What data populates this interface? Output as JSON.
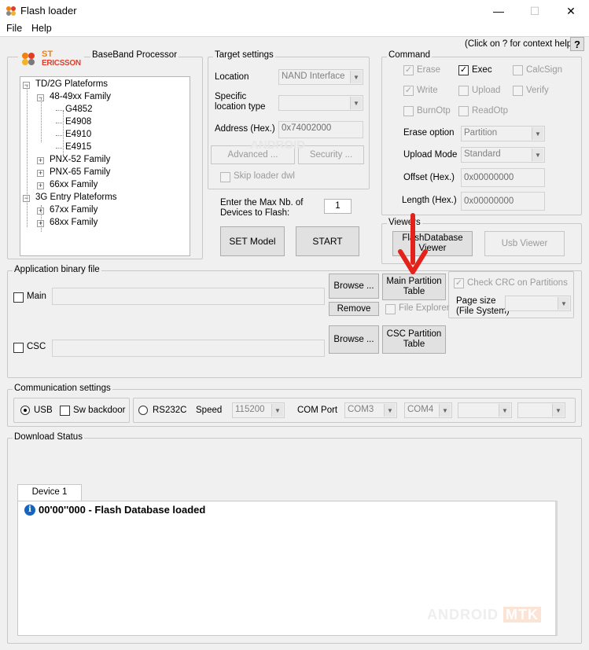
{
  "window": {
    "title": "Flash loader",
    "minimize": "—",
    "maximize": "☐",
    "close": "✕"
  },
  "menu": {
    "file": "File",
    "help": "Help"
  },
  "help": {
    "label": "(Click on ? for context help)",
    "button": "?"
  },
  "logo": {
    "line1": "ST",
    "line2": "ERICSSON"
  },
  "baseband": {
    "title": "BaseBand Processor",
    "tree": [
      {
        "label": "TD/2G Plateforms",
        "box": "−"
      },
      {
        "label": "48-49xx Family",
        "box": "−"
      },
      {
        "label": "G4852"
      },
      {
        "label": "E4908"
      },
      {
        "label": "E4910"
      },
      {
        "label": "E4915"
      },
      {
        "label": "PNX-52 Family",
        "box": "+"
      },
      {
        "label": "PNX-65 Family",
        "box": "+"
      },
      {
        "label": "66xx Family",
        "box": "+"
      },
      {
        "label": "3G Entry Plateforms",
        "box": "−"
      },
      {
        "label": "67xx Family",
        "box": "+"
      },
      {
        "label": "68xx Family",
        "box": "+"
      }
    ]
  },
  "target": {
    "title": "Target settings",
    "location_label": "Location",
    "location_value": "NAND Interface",
    "specific_label1": "Specific",
    "specific_label2": "location type",
    "address_label": "Address (Hex.)",
    "address_value": "0x74002000",
    "advanced": "Advanced ...",
    "security": "Security ...",
    "skip": "Skip loader dwl",
    "watermark": "ANDROID"
  },
  "max_devices": {
    "label1": "Enter the Max Nb. of",
    "label2": "Devices to Flash:",
    "value": "1"
  },
  "buttons": {
    "set_model": "SET Model",
    "start": "START"
  },
  "command": {
    "title": "Command",
    "erase": "Erase",
    "exec": "Exec",
    "calcsign": "CalcSign",
    "write": "Write",
    "upload": "Upload",
    "verify": "Verify",
    "burnotp": "BurnOtp",
    "readotp": "ReadOtp",
    "erase_option_label": "Erase option",
    "erase_option_value": "Partition",
    "upload_mode_label": "Upload Mode",
    "upload_mode_value": "Standard",
    "offset_label": "Offset (Hex.)",
    "offset_value": "0x00000000",
    "length_label": "Length (Hex.)",
    "length_value": "0x00000000"
  },
  "viewers": {
    "title": "Viewers",
    "flash_db": "FlashDatabase Viewer",
    "usb": "Usb Viewer"
  },
  "app_binary": {
    "title": "Application binary file",
    "main": "Main",
    "csc": "CSC",
    "browse": "Browse ...",
    "remove": "Remove",
    "main_partition": "Main Partition Table",
    "file_explorer": "File Explorer",
    "csc_partition": "CSC Partition Table",
    "check_crc": "Check CRC on Partitions",
    "page_size1": "Page size",
    "page_size2": "(File System)"
  },
  "comm": {
    "title": "Communication settings",
    "usb": "USB",
    "sw_backdoor": "Sw backdoor",
    "rs232c": "RS232C",
    "speed_label": "Speed",
    "speed_value": "115200",
    "com_port_label": "COM Port",
    "com1": "COM3",
    "com2": "COM4"
  },
  "download": {
    "title": "Download Status",
    "tab": "Device 1",
    "message": "00'00''000 - Flash Database loaded",
    "watermark1": "ANDROID",
    "watermark2": "MTK"
  },
  "colors": {
    "arrow": "#e3221b",
    "info": "#1565c0",
    "logo_orange": "#f0820f",
    "logo_red": "#e23d28"
  }
}
